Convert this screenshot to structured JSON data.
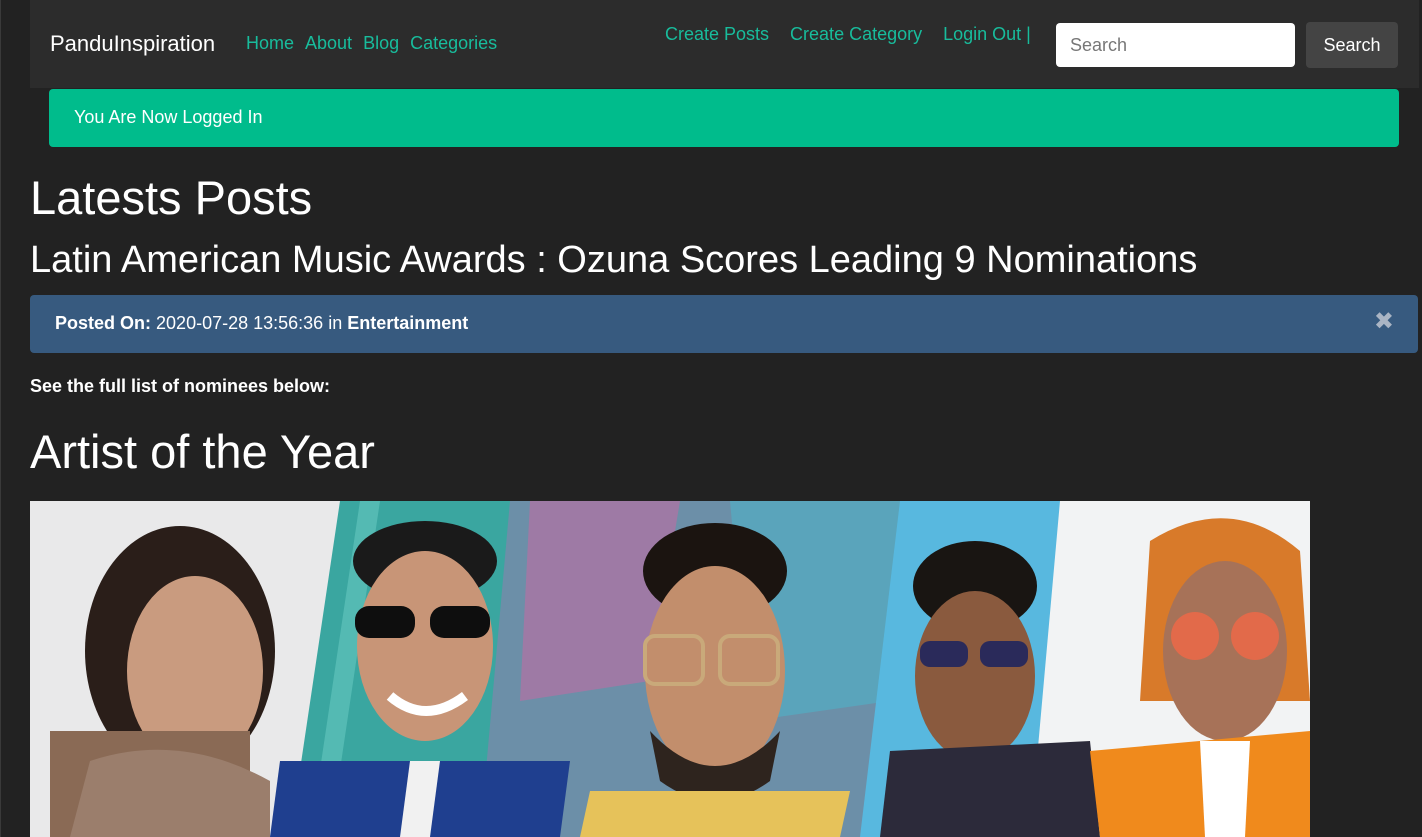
{
  "navbar": {
    "brand": "PanduInspiration",
    "left_links": [
      "Home",
      "About",
      "Blog",
      "Categories"
    ],
    "right_links": [
      "Create Posts",
      "Create Category",
      "Login Out |"
    ],
    "search": {
      "placeholder": "Search",
      "button_label": "Search"
    }
  },
  "alert": {
    "message": "You Are Now Logged In"
  },
  "page": {
    "heading": "Latests Posts"
  },
  "post": {
    "title": "Latin American Music Awards : Ozuna Scores Leading 9 Nominations",
    "meta": {
      "posted_on_label": "Posted On:",
      "date": "2020-07-28 13:56:36",
      "in_label": "in",
      "category": "Entertainment",
      "close_icon": "close-icon"
    },
    "intro": "See the full list of nominees below:",
    "section_heading": "Artist of the Year"
  },
  "colors": {
    "background": "#222222",
    "navbar": "#2c2c2c",
    "link": "#18bc9c",
    "alert_success": "#00bc8c",
    "alert_info": "#375a7f"
  }
}
